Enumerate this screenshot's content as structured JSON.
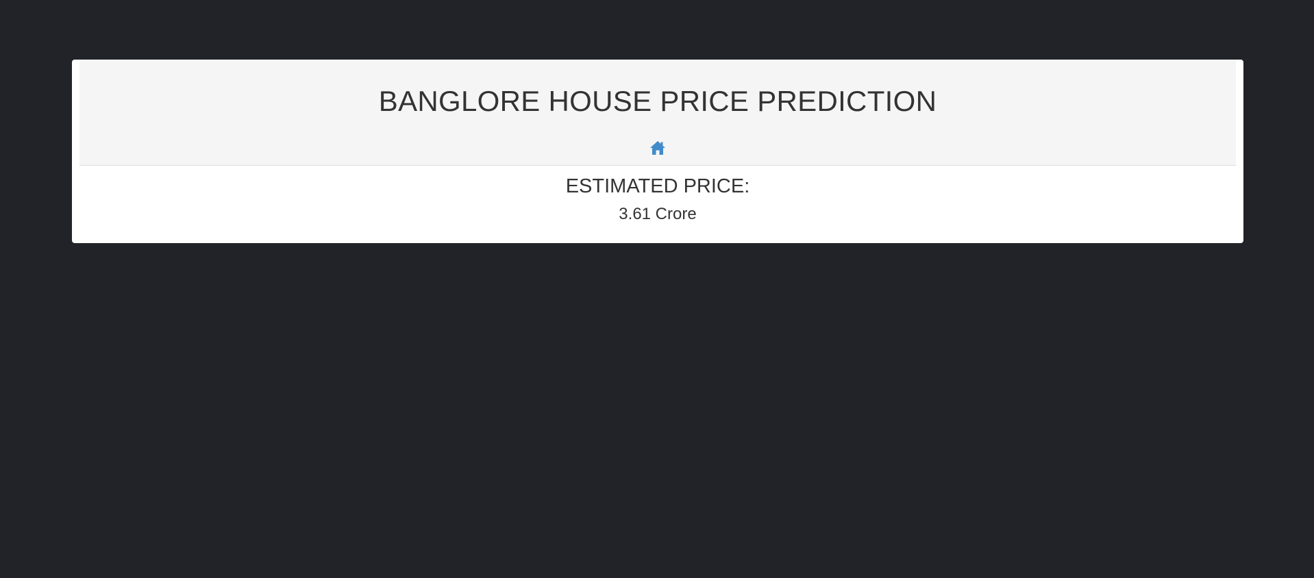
{
  "header": {
    "title": "BANGLORE HOUSE PRICE PREDICTION",
    "home_icon": "home-icon"
  },
  "result": {
    "label": "ESTIMATED PRICE:",
    "value": "3.61 Crore"
  },
  "colors": {
    "background": "#212328",
    "card": "#ffffff",
    "header": "#f5f5f5",
    "accent": "#428bca",
    "text": "#333333"
  }
}
